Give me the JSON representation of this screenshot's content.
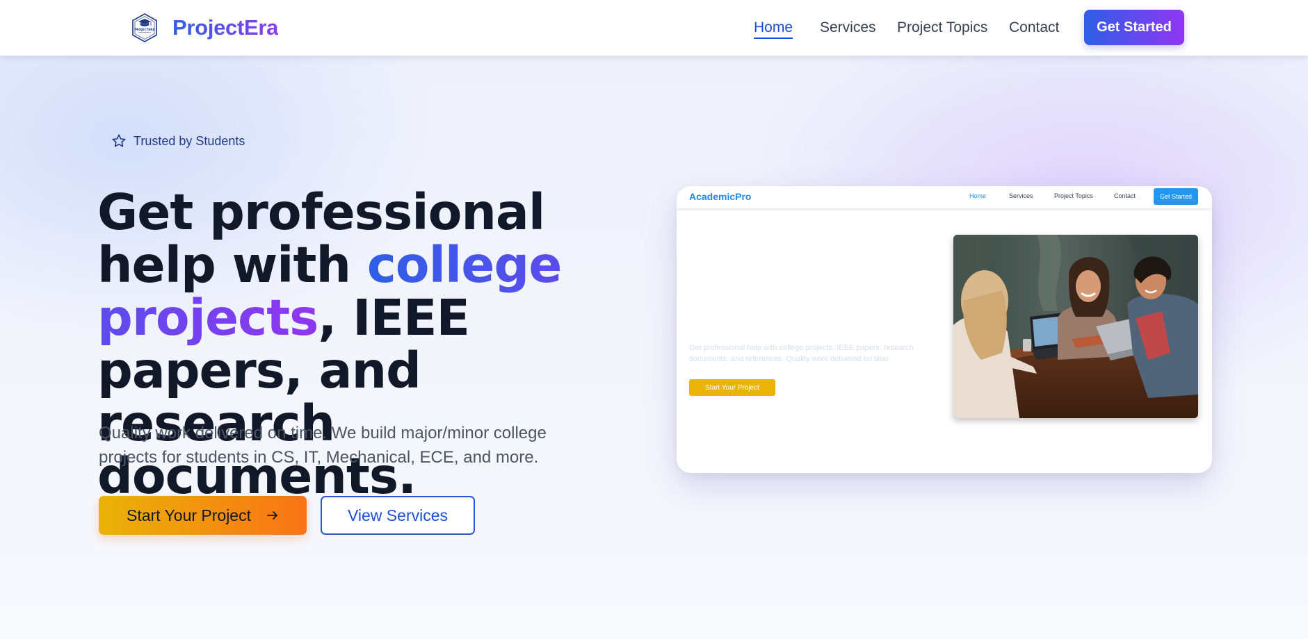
{
  "brand": {
    "name": "ProjectEra",
    "logo_icon": "graduation-cap-hexagon-logo",
    "logo_text": "PROJECTERA",
    "colors": {
      "gradient_start": "#2f5fe6",
      "gradient_end": "#8b3cf0"
    }
  },
  "nav": {
    "links": [
      {
        "label": "Home",
        "active": true
      },
      {
        "label": "Services",
        "active": false
      },
      {
        "label": "Project Topics",
        "active": false
      },
      {
        "label": "Contact",
        "active": false
      }
    ],
    "cta_label": "Get Started"
  },
  "hero": {
    "badge": {
      "icon": "star-icon",
      "text": "Trusted by Students"
    },
    "headline": {
      "part1": "Get professional help with",
      "highlight": "college projects",
      "part2": ", IEEE papers, and research documents."
    },
    "subtext": "Quality work delivered on time. We build major/minor college projects for students in CS, IT, Mechanical, ECE, and more.",
    "primary_button": {
      "label": "Start Your Project",
      "icon": "arrow-right-icon"
    },
    "secondary_button": {
      "label": "View Services"
    },
    "colors": {
      "primary_gradient": [
        "#eab308",
        "#f97316"
      ],
      "secondary_border": "#2557d6"
    }
  },
  "mockup": {
    "brand": "AcademicPro",
    "links": [
      "Home",
      "Services",
      "Project Topics",
      "Contact"
    ],
    "cta_label": "Get Started",
    "text": "Get professional help with college projects, IEEE papers, research documents, and references. Quality work delivered on time.",
    "button_label": "Start Your Project",
    "photo": "students-collaborating-at-table-photo",
    "colors": {
      "accent": "#2196f3",
      "button": "#eab308"
    }
  }
}
